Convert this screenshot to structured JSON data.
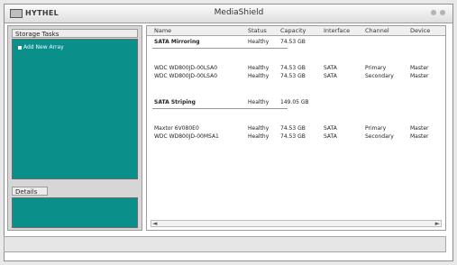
{
  "app": {
    "logo_text": "HYTHEL",
    "window_title": "MediaShield"
  },
  "left": {
    "tasks_header": "Storage Tasks",
    "tasks": [
      {
        "label": "Add New Array"
      }
    ],
    "details_header": "Details"
  },
  "columns": [
    "Name",
    "Status",
    "Capacity",
    "Interface",
    "Channel",
    "Device"
  ],
  "rows": [
    {
      "name": "SATA Mirroring",
      "status": "Healthy",
      "capacity": "74.53 GB",
      "interface": "",
      "channel": "",
      "device": "",
      "bold": true
    },
    {
      "name": "",
      "status": "",
      "capacity": "",
      "interface": "",
      "channel": "",
      "device": ""
    },
    {
      "name": "WDC WD800JD-00LSA0",
      "status": "Healthy",
      "capacity": "74.53 GB",
      "interface": "SATA",
      "channel": "Primary",
      "device": "Master"
    },
    {
      "name": "WDC WD800JD-00LSA0",
      "status": "Healthy",
      "capacity": "74.53 GB",
      "interface": "SATA",
      "channel": "Secondary",
      "device": "Master"
    },
    {
      "name": "",
      "status": "",
      "capacity": "",
      "interface": "",
      "channel": "",
      "device": ""
    },
    {
      "name": "SATA Striping",
      "status": "Healthy",
      "capacity": "149.05 GB",
      "interface": "",
      "channel": "",
      "device": "",
      "bold": true
    },
    {
      "name": "",
      "status": "",
      "capacity": "",
      "interface": "",
      "channel": "",
      "device": ""
    },
    {
      "name": "Maxtor 6V080E0",
      "status": "Healthy",
      "capacity": "74.53 GB",
      "interface": "SATA",
      "channel": "Primary",
      "device": "Master"
    },
    {
      "name": "WDC WD800JD-00MSA1",
      "status": "Healthy",
      "capacity": "74.53 GB",
      "interface": "SATA",
      "channel": "Secondary",
      "device": "Master"
    }
  ],
  "colors": {
    "panel_teal": "#0b8f8b"
  },
  "icons": {
    "scroll_left": "◄",
    "scroll_right": "►"
  }
}
